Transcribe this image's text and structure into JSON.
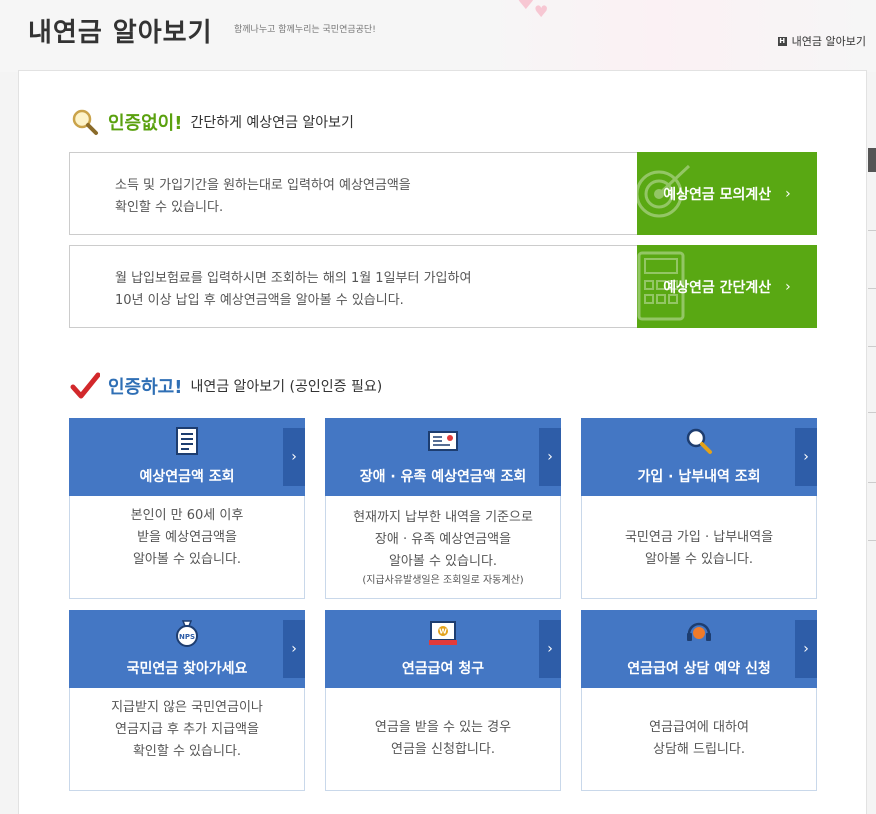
{
  "header": {
    "title": "내연금 알아보기",
    "slogan": "함께나누고 함께누리는 국민연금공단!",
    "breadcrumb": "내연금 알아보기"
  },
  "section1": {
    "emph": "인증없이!",
    "sub": "간단하게 예상연금 알아보기",
    "rows": [
      {
        "line1": "소득 및 가입기간을 원하는대로 입력하여 예상연금액을",
        "line2": "확인할 수 있습니다.",
        "button": "예상연금 모의계산"
      },
      {
        "line1": "월 납입보험료를 입력하시면 조회하는 해의 1월 1일부터 가입하여",
        "line2": "10년 이상 납입 후 예상연금액을 알아볼 수 있습니다.",
        "button": "예상연금 간단계산"
      }
    ]
  },
  "section2": {
    "emph": "인증하고!",
    "sub": "내연금 알아보기 (공인인증 필요)",
    "cards": [
      {
        "title": "예상연금액 조회",
        "lines": [
          "본인이 만 60세 이후",
          "받을 예상연금액을",
          "알아볼 수 있습니다."
        ],
        "note": ""
      },
      {
        "title": "장애 · 유족 예상연금액 조회",
        "lines": [
          "현재까지 납부한 내역을 기준으로",
          "장애 · 유족 예상연금액을",
          "알아볼 수 있습니다."
        ],
        "note": "(지급사유발생일은 조회일로 자동계산)"
      },
      {
        "title": "가입 · 납부내역 조회",
        "lines": [
          "국민연금 가입 · 납부내역을",
          "알아볼 수 있습니다."
        ],
        "note": ""
      },
      {
        "title": "국민연금 찾아가세요",
        "lines": [
          "지급받지 않은 국민연금이나",
          "연금지급 후 추가 지급액을",
          "확인할 수 있습니다."
        ],
        "note": ""
      },
      {
        "title": "연금급여 청구",
        "lines": [
          "연금을 받을 수 있는 경우",
          "연금을 신청합니다."
        ],
        "note": ""
      },
      {
        "title": "연금급여 상담 예약 신청",
        "lines": [
          "연금급여에 대하여",
          "상담해 드립니다."
        ],
        "note": ""
      }
    ]
  },
  "icons": {
    "magnifier": "magnifier-icon",
    "check": "check-icon",
    "arrow": "chevron-right-icon"
  },
  "colors": {
    "green": "#59a813",
    "blue": "#4477c4",
    "blue_dark": "#2e5da8"
  }
}
